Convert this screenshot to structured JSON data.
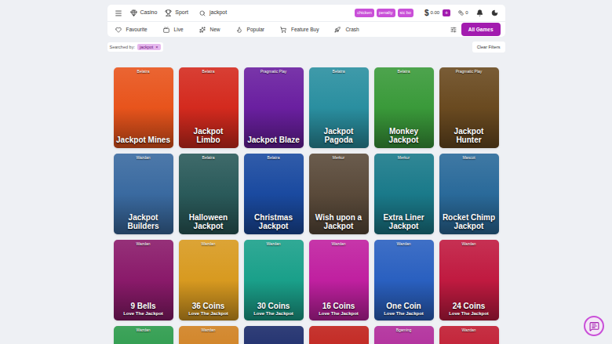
{
  "top_bar": {
    "links": [
      {
        "label": "Casino"
      },
      {
        "label": "Sport"
      }
    ],
    "search": {
      "value": "jackpot"
    },
    "quick_tags": [
      "chicken",
      "penalty",
      "sic bo"
    ],
    "balance": {
      "currency": "$",
      "amount": "0.00",
      "add": "+"
    },
    "bonus_count": "0"
  },
  "category_tabs": [
    {
      "label": "Favourite",
      "selected": false
    },
    {
      "label": "Live",
      "selected": false
    },
    {
      "label": "New",
      "selected": false
    },
    {
      "label": "Popular",
      "selected": false
    },
    {
      "label": "Feature Buy",
      "selected": false
    },
    {
      "label": "Crash",
      "selected": false
    }
  ],
  "all_games": {
    "label": "All Games",
    "selected": true
  },
  "filters": {
    "label": "Searched by:",
    "chips": [
      {
        "label": "jackpot",
        "remove": "×"
      }
    ],
    "clear": "Clear Filters"
  },
  "games": [
    {
      "provider": "Belatra",
      "title": "Jackpot Mines",
      "color": "#e8541c"
    },
    {
      "provider": "Belatra",
      "title": "Jackpot Limbo",
      "color": "#d42a1e"
    },
    {
      "provider": "Pragmatic Play",
      "title": "Jackpot Blaze",
      "color": "#6a1fa0"
    },
    {
      "provider": "Belatra",
      "title": "Jackpot Pagoda",
      "color": "#2a8fa0"
    },
    {
      "provider": "Belatra",
      "title": "Monkey Jackpot",
      "color": "#3a9a3a"
    },
    {
      "provider": "Pragmatic Play",
      "title": "Jackpot Hunter",
      "color": "#6a4a20"
    },
    {
      "provider": "Wazdan",
      "title": "Jackpot Builders",
      "color": "#3a6aa0"
    },
    {
      "provider": "Belatra",
      "title": "Halloween Jackpot",
      "color": "#2a5a5a"
    },
    {
      "provider": "Belatra",
      "title": "Christmas Jackpot",
      "color": "#1a4aa0"
    },
    {
      "provider": "Merkur",
      "title": "Wish upon a Jackpot",
      "color": "#5a4a3a"
    },
    {
      "provider": "Merkur",
      "title": "Extra Liner Jackpot",
      "color": "#1a7a8a"
    },
    {
      "provider": "Mascot",
      "title": "Rocket Chimp Jackpot",
      "color": "#2a6a9a"
    },
    {
      "provider": "Wazdan",
      "title": "9 Bells",
      "subtitle": "Love The Jackpot",
      "color": "#8a1a6a"
    },
    {
      "provider": "Wazdan",
      "title": "36 Coins",
      "subtitle": "Love The Jackpot",
      "color": "#d89a20"
    },
    {
      "provider": "Wazdan",
      "title": "30 Coins",
      "subtitle": "Love The Jackpot",
      "color": "#1aa08a"
    },
    {
      "provider": "Wazdan",
      "title": "16 Coins",
      "subtitle": "Love The Jackpot",
      "color": "#c020a0"
    },
    {
      "provider": "Wazdan",
      "title": "One Coin",
      "subtitle": "Love The Jackpot",
      "color": "#2a60c0"
    },
    {
      "provider": "Wazdan",
      "title": "24 Coins",
      "subtitle": "Love The Jackpot",
      "color": "#c01a40"
    },
    {
      "provider": "Wazdan",
      "color": "#2a9a4a"
    },
    {
      "provider": "Wazdan",
      "color": "#d08020"
    },
    {
      "color": "#1a2a6a"
    },
    {
      "color": "#c0201a"
    },
    {
      "provider": "Bgaming",
      "color": "#b02a9a"
    },
    {
      "provider": "Wazdan",
      "color": "#c01a30"
    }
  ]
}
